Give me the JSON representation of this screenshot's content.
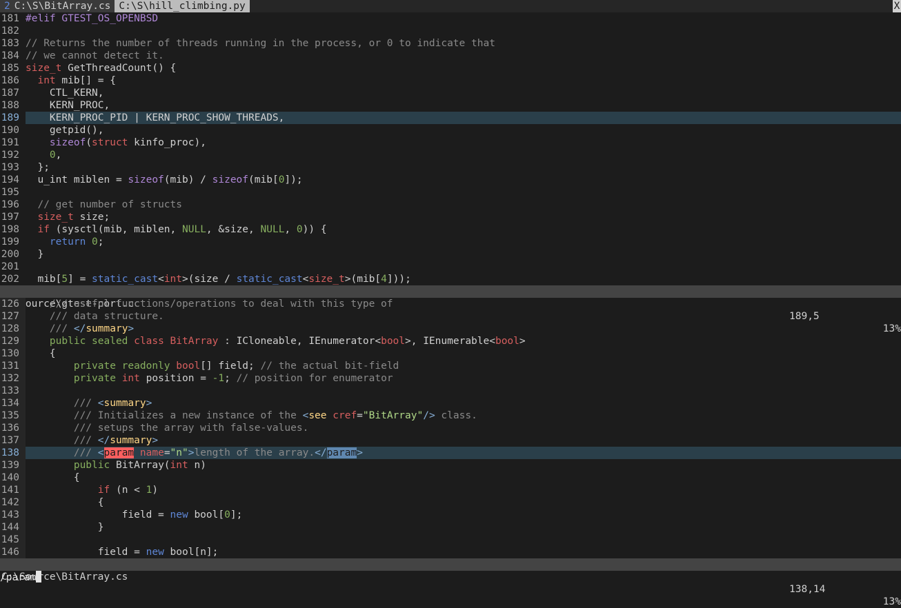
{
  "tabs": [
    {
      "num": "2",
      "label": "C:\\S\\BitArray.cs",
      "active": false
    },
    {
      "label": "C:\\S\\hill_climbing.py",
      "active": true
    }
  ],
  "close_label": "X",
  "top_pane": {
    "status": {
      "file": "C:\\Source\\gtest-port.cc",
      "position": "189,5",
      "percent": "13%"
    },
    "lines": [
      {
        "n": "181",
        "tokens": [
          [
            "c-pre",
            "#elif GTEST_OS_OPENBSD"
          ]
        ]
      },
      {
        "n": "182",
        "tokens": []
      },
      {
        "n": "183",
        "tokens": [
          [
            "c-cm",
            "// Returns the number of threads running in the process, or 0 to indicate that"
          ]
        ]
      },
      {
        "n": "184",
        "tokens": [
          [
            "c-cm",
            "// we cannot detect it."
          ]
        ]
      },
      {
        "n": "185",
        "tokens": [
          [
            "c-ty",
            "size_t"
          ],
          [
            "",
            " GetThreadCount() {"
          ]
        ]
      },
      {
        "n": "186",
        "tokens": [
          [
            "",
            "  "
          ],
          [
            "c-ty",
            "int"
          ],
          [
            "",
            " mib[] = {"
          ]
        ]
      },
      {
        "n": "187",
        "tokens": [
          [
            "",
            "    CTL_KERN,"
          ]
        ]
      },
      {
        "n": "188",
        "tokens": [
          [
            "",
            "    KERN_PROC,"
          ]
        ]
      },
      {
        "n": "189",
        "cursor": true,
        "tokens": [
          [
            "",
            "    KERN_PROC_PID | KERN_PROC_SHOW_THREADS,"
          ]
        ]
      },
      {
        "n": "190",
        "tokens": [
          [
            "",
            "    getpid(),"
          ]
        ]
      },
      {
        "n": "191",
        "tokens": [
          [
            "",
            "    "
          ],
          [
            "c-fn",
            "sizeof"
          ],
          [
            "",
            "("
          ],
          [
            "c-ty",
            "struct"
          ],
          [
            "",
            " kinfo_proc),"
          ]
        ]
      },
      {
        "n": "192",
        "tokens": [
          [
            "",
            "    "
          ],
          [
            "c-num",
            "0"
          ],
          [
            "",
            ","
          ]
        ]
      },
      {
        "n": "193",
        "tokens": [
          [
            "",
            "  };"
          ]
        ]
      },
      {
        "n": "194",
        "tokens": [
          [
            "",
            "  u_int miblen = "
          ],
          [
            "c-fn",
            "sizeof"
          ],
          [
            "",
            "(mib) / "
          ],
          [
            "c-fn",
            "sizeof"
          ],
          [
            "",
            "(mib["
          ],
          [
            "c-num",
            "0"
          ],
          [
            "",
            "]);"
          ]
        ]
      },
      {
        "n": "195",
        "tokens": []
      },
      {
        "n": "196",
        "tokens": [
          [
            "",
            "  "
          ],
          [
            "c-cm",
            "// get number of structs"
          ]
        ]
      },
      {
        "n": "197",
        "tokens": [
          [
            "",
            "  "
          ],
          [
            "c-ty",
            "size_t"
          ],
          [
            "",
            " size;"
          ]
        ]
      },
      {
        "n": "198",
        "tokens": [
          [
            "",
            "  "
          ],
          [
            "c-ty",
            "if"
          ],
          [
            "",
            " (sysctl(mib, miblen, "
          ],
          [
            "c-num",
            "NULL"
          ],
          [
            "",
            ", &size, "
          ],
          [
            "c-num",
            "NULL"
          ],
          [
            "",
            ", "
          ],
          [
            "c-num",
            "0"
          ],
          [
            "",
            ")) {"
          ]
        ]
      },
      {
        "n": "199",
        "tokens": [
          [
            "",
            "    "
          ],
          [
            "c-blue",
            "return"
          ],
          [
            "",
            " "
          ],
          [
            "c-num",
            "0"
          ],
          [
            "",
            ";"
          ]
        ]
      },
      {
        "n": "200",
        "tokens": [
          [
            "",
            "  }"
          ]
        ]
      },
      {
        "n": "201",
        "tokens": []
      },
      {
        "n": "202",
        "tokens": [
          [
            "",
            "  mib["
          ],
          [
            "c-num",
            "5"
          ],
          [
            "",
            "] = "
          ],
          [
            "c-blue",
            "static_cast"
          ],
          [
            "",
            "<"
          ],
          [
            "c-ty",
            "int"
          ],
          [
            "",
            ">(size / "
          ],
          [
            "c-blue",
            "static_cast"
          ],
          [
            "",
            "<"
          ],
          [
            "c-ty",
            "size_t"
          ],
          [
            "",
            ">(mib["
          ],
          [
            "c-num",
            "4"
          ],
          [
            "",
            "]));"
          ]
        ]
      }
    ]
  },
  "bottom_pane": {
    "status": {
      "file": "C:\\Source\\BitArray.cs",
      "position": "138,14",
      "percent": "13%"
    },
    "lines": [
      {
        "n": "126",
        "tokens": [
          [
            "c-cm",
            "    /// useful functions/operations to deal with this type of"
          ]
        ]
      },
      {
        "n": "127",
        "tokens": [
          [
            "c-cm",
            "    /// data structure."
          ]
        ]
      },
      {
        "n": "128",
        "tokens": [
          [
            "c-cm",
            "    /// "
          ],
          [
            "c-tag",
            "</"
          ],
          [
            "c-yellow",
            "summary"
          ],
          [
            "c-tag",
            ">"
          ]
        ]
      },
      {
        "n": "129",
        "tokens": [
          [
            "",
            "    "
          ],
          [
            "c-cs-kw",
            "public sealed"
          ],
          [
            "",
            " "
          ],
          [
            "c-cs-ty",
            "class"
          ],
          [
            "",
            " "
          ],
          [
            "c-cs-ty",
            "BitArray"
          ],
          [
            "",
            " : ICloneable, IEnumerator<"
          ],
          [
            "c-cs-ty",
            "bool"
          ],
          [
            "",
            ">, IEnumerable<"
          ],
          [
            "c-cs-ty",
            "bool"
          ],
          [
            "",
            ">"
          ]
        ]
      },
      {
        "n": "130",
        "tokens": [
          [
            "",
            "    {"
          ]
        ]
      },
      {
        "n": "131",
        "tokens": [
          [
            "",
            "        "
          ],
          [
            "c-cs-kw",
            "private readonly"
          ],
          [
            "",
            " "
          ],
          [
            "c-cs-ty",
            "bool"
          ],
          [
            "",
            "[] field; "
          ],
          [
            "c-cm",
            "// the actual bit-field"
          ]
        ]
      },
      {
        "n": "132",
        "tokens": [
          [
            "",
            "        "
          ],
          [
            "c-cs-kw",
            "private"
          ],
          [
            "",
            " "
          ],
          [
            "c-cs-ty",
            "int"
          ],
          [
            "",
            " position = "
          ],
          [
            "c-num",
            "-1"
          ],
          [
            "",
            "; "
          ],
          [
            "c-cm",
            "// position for enumerator"
          ]
        ]
      },
      {
        "n": "133",
        "tokens": []
      },
      {
        "n": "134",
        "tokens": [
          [
            "c-cm",
            "        /// "
          ],
          [
            "c-tag",
            "<"
          ],
          [
            "c-yellow",
            "summary"
          ],
          [
            "c-tag",
            ">"
          ]
        ]
      },
      {
        "n": "135",
        "tokens": [
          [
            "c-cm",
            "        /// Initializes a new instance of the "
          ],
          [
            "c-tag",
            "<"
          ],
          [
            "c-yellow",
            "see"
          ],
          [
            "",
            " "
          ],
          [
            "c-attr",
            "cref"
          ],
          [
            "",
            "="
          ],
          [
            "c-str",
            "\"BitArray\""
          ],
          [
            "c-tag",
            "/>"
          ],
          [
            "c-cm",
            " class."
          ]
        ]
      },
      {
        "n": "136",
        "tokens": [
          [
            "c-cm",
            "        /// setups the array with false-values."
          ]
        ]
      },
      {
        "n": "137",
        "tokens": [
          [
            "c-cm",
            "        /// "
          ],
          [
            "c-tag",
            "</"
          ],
          [
            "c-yellow",
            "summary"
          ],
          [
            "c-tag",
            ">"
          ]
        ]
      },
      {
        "n": "138",
        "cursor": true,
        "tokens": [
          [
            "c-cm",
            "        /// "
          ],
          [
            "c-tag",
            "<"
          ],
          [
            "hl-search",
            "param"
          ],
          [
            "",
            " "
          ],
          [
            "c-attr",
            "name"
          ],
          [
            "",
            "="
          ],
          [
            "c-str",
            "\"n\""
          ],
          [
            "c-tag",
            ">"
          ],
          [
            "c-cm",
            "length of the array."
          ],
          [
            "c-tag",
            "</"
          ],
          [
            "hl-search2",
            "param"
          ],
          [
            "c-tag",
            ">"
          ]
        ]
      },
      {
        "n": "139",
        "tokens": [
          [
            "",
            "        "
          ],
          [
            "c-cs-kw",
            "public"
          ],
          [
            "",
            " BitArray("
          ],
          [
            "c-cs-ty",
            "int"
          ],
          [
            "",
            " n)"
          ]
        ]
      },
      {
        "n": "140",
        "tokens": [
          [
            "",
            "        {"
          ]
        ]
      },
      {
        "n": "141",
        "tokens": [
          [
            "",
            "            "
          ],
          [
            "c-cs-ty",
            "if"
          ],
          [
            "",
            " (n < "
          ],
          [
            "c-num",
            "1"
          ],
          [
            "",
            ")"
          ]
        ]
      },
      {
        "n": "142",
        "tokens": [
          [
            "",
            "            {"
          ]
        ]
      },
      {
        "n": "143",
        "tokens": [
          [
            "",
            "                field = "
          ],
          [
            "c-blue",
            "new"
          ],
          [
            "",
            " bool["
          ],
          [
            "c-num",
            "0"
          ],
          [
            "",
            "];"
          ]
        ]
      },
      {
        "n": "144",
        "tokens": [
          [
            "",
            "            }"
          ]
        ]
      },
      {
        "n": "145",
        "tokens": []
      },
      {
        "n": "146",
        "tokens": [
          [
            "",
            "            field = "
          ],
          [
            "c-blue",
            "new"
          ],
          [
            "",
            " bool[n];"
          ]
        ]
      }
    ]
  },
  "command_line": "/param",
  "colors": {
    "background": "#1c1c1c",
    "cursorline": "#2a3f4a",
    "statusline": "#444444",
    "search_hl": "#ff5f5f"
  }
}
